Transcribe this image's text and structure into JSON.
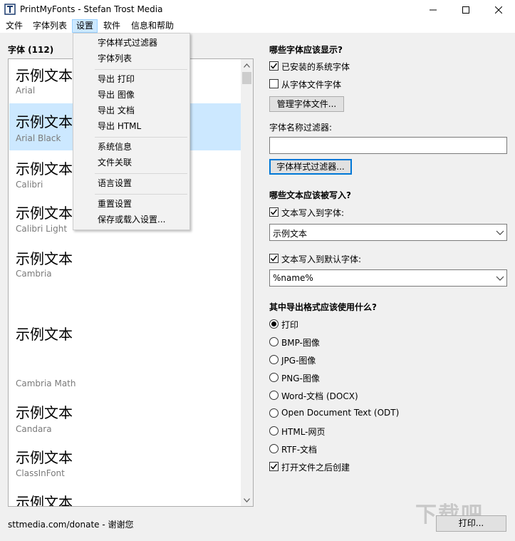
{
  "window": {
    "title": "PrintMyFonts - Stefan Trost Media"
  },
  "menubar": {
    "items": [
      "文件",
      "字体列表",
      "设置",
      "软件",
      "信息和帮助"
    ]
  },
  "settings_menu": {
    "items": [
      "字体样式过滤器",
      "字体列表",
      "导出 打印",
      "导出 图像",
      "导出 文档",
      "导出 HTML",
      "系统信息",
      "文件关联",
      "语言设置",
      "重置设置",
      "保存或载入设置..."
    ]
  },
  "font_list": {
    "header": "字体 (112)",
    "entries": [
      {
        "sample": "示例文本",
        "name": "Arial"
      },
      {
        "sample": "示例文本",
        "name": "Arial Black"
      },
      {
        "sample": "示例文本",
        "name": "Calibri"
      },
      {
        "sample": "示例文本",
        "name": "Calibri Light"
      },
      {
        "sample": "示例文本",
        "name": "Cambria"
      },
      {
        "sample": "示例文本",
        "name": "Cambria Math"
      },
      {
        "sample": "示例文本",
        "name": "Candara"
      },
      {
        "sample": "示例文本",
        "name": "ClassInFont"
      },
      {
        "sample": "示例文本",
        "name": ""
      }
    ]
  },
  "options": {
    "which_fonts_heading": "哪些字体应该显示?",
    "installed_label": "已安装的系统字体",
    "installed_checked": true,
    "from_files_label": "从字体文件字体",
    "from_files_checked": false,
    "manage_button": "管理字体文件...",
    "name_filter_label": "字体名称过滤器:",
    "name_filter_value": "",
    "style_filter_button": "字体样式过滤器...",
    "which_text_heading": "哪些文本应该被写入?",
    "write_font_label": "文本写入到字体:",
    "write_font_checked": true,
    "write_font_value": "示例文本",
    "write_default_label": "文本写入到默认字体:",
    "write_default_checked": true,
    "write_default_value": "%name%",
    "format_heading": "其中导出格式应该使用什么?",
    "formats": [
      "打印",
      "BMP-图像",
      "JPG-图像",
      "PNG-图像",
      "Word-文档 (DOCX)",
      "Open Document Text (ODT)",
      "HTML-网页",
      "RTF-文档"
    ],
    "selected_format": "打印",
    "open_after_label": "打开文件之后创建",
    "open_after_checked": true
  },
  "status": {
    "text": "sttmedia.com/donate - 谢谢您",
    "print_button": "打印..."
  },
  "watermark": "下载吧"
}
